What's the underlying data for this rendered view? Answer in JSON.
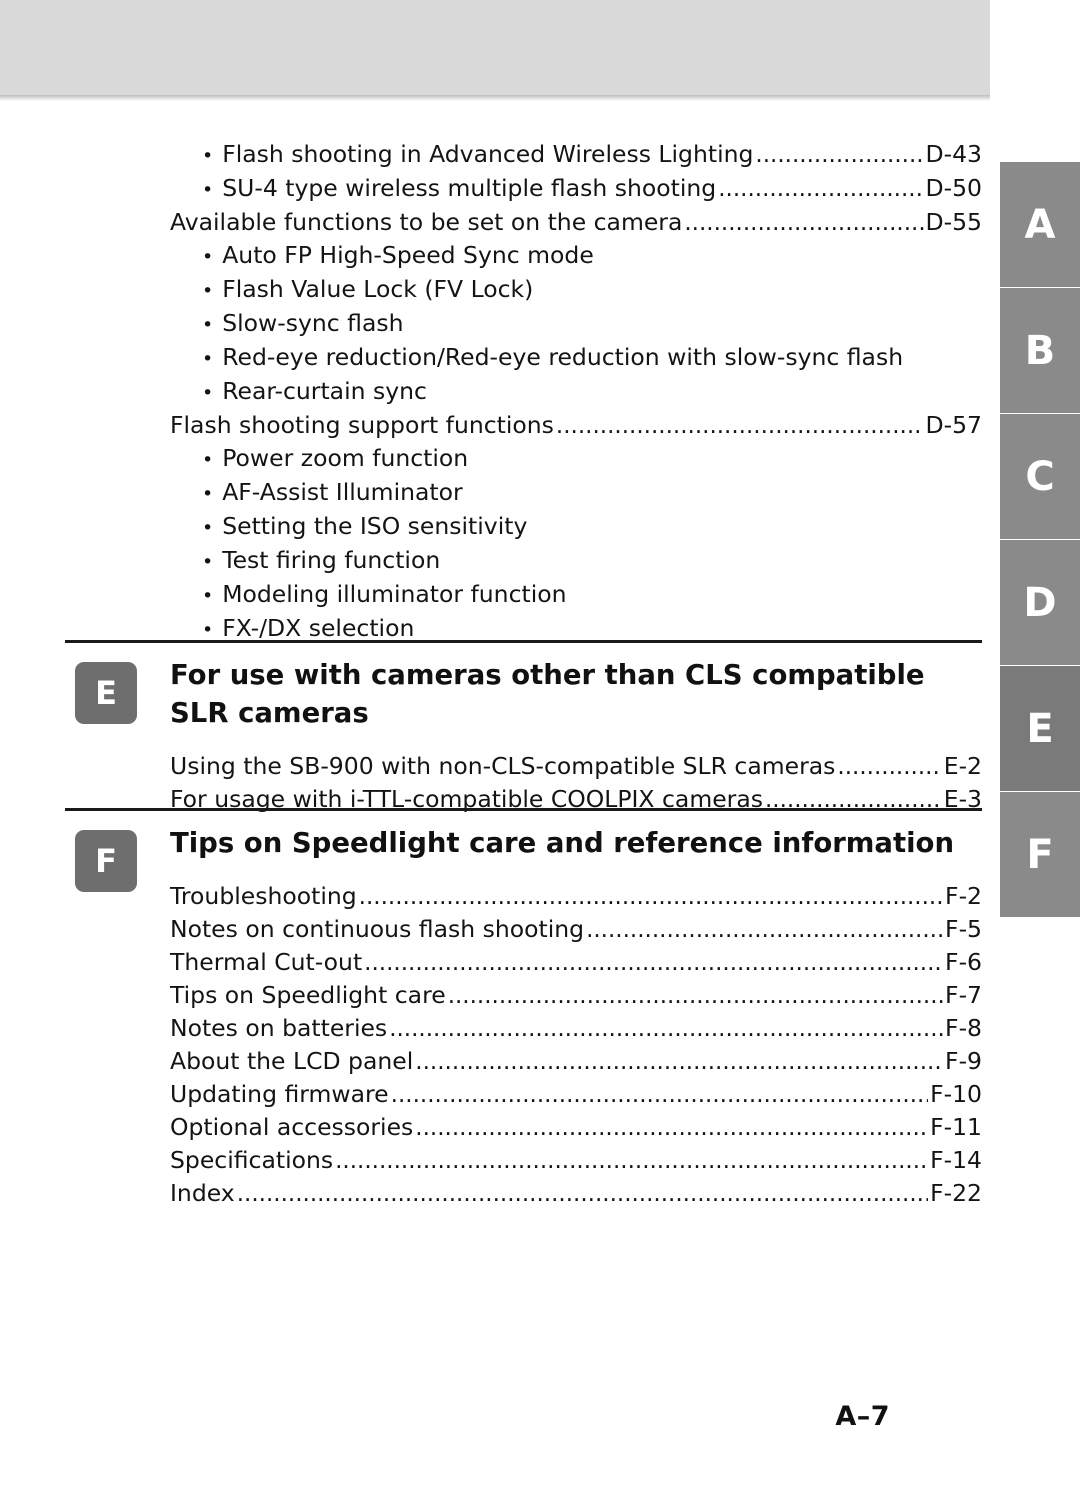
{
  "page": {
    "number_label": "A–7"
  },
  "thumb_index": {
    "tabs": [
      {
        "label": "A",
        "color": "#8a8a8a"
      },
      {
        "label": "B",
        "color": "#8a8a8a"
      },
      {
        "label": "C",
        "color": "#8a8a8a"
      },
      {
        "label": "D",
        "color": "#8a8a8a"
      },
      {
        "label": "E",
        "color": "#7a7a7a"
      },
      {
        "label": "F",
        "color": "#8a8a8a"
      }
    ]
  },
  "toc": {
    "top_entries": [
      {
        "bullet": "•",
        "text": "Flash shooting in Advanced Wireless Lighting",
        "page": "D-43",
        "indent": true,
        "dots": true
      },
      {
        "bullet": "•",
        "text": "SU-4 type wireless multiple flash shooting",
        "page": "D-50",
        "indent": true,
        "dots": true
      },
      {
        "bullet": "",
        "text": "Available functions to be set on the camera",
        "page": "D-55",
        "indent": false,
        "dots": true
      },
      {
        "bullet": "•",
        "text": "Auto FP High-Speed Sync mode",
        "page": "",
        "indent": true,
        "dots": false
      },
      {
        "bullet": "•",
        "text": "Flash Value Lock (FV Lock)",
        "page": "",
        "indent": true,
        "dots": false
      },
      {
        "bullet": "•",
        "text": "Slow-sync flash",
        "page": "",
        "indent": true,
        "dots": false
      },
      {
        "bullet": "•",
        "text": "Red-eye reduction/Red-eye reduction with slow-sync flash",
        "page": "",
        "indent": true,
        "dots": false
      },
      {
        "bullet": "•",
        "text": "Rear-curtain sync",
        "page": "",
        "indent": true,
        "dots": false
      },
      {
        "bullet": "",
        "text": "Flash shooting support functions",
        "page": "D-57",
        "indent": false,
        "dots": true
      },
      {
        "bullet": "•",
        "text": "Power zoom function",
        "page": "",
        "indent": true,
        "dots": false
      },
      {
        "bullet": "•",
        "text": "AF-Assist Illuminator",
        "page": "",
        "indent": true,
        "dots": false
      },
      {
        "bullet": "•",
        "text": "Setting the ISO sensitivity",
        "page": "",
        "indent": true,
        "dots": false
      },
      {
        "bullet": "•",
        "text": "Test firing function",
        "page": "",
        "indent": true,
        "dots": false
      },
      {
        "bullet": "•",
        "text": "Modeling illuminator function",
        "page": "",
        "indent": true,
        "dots": false
      },
      {
        "bullet": "•",
        "text": "FX-/DX selection",
        "page": "",
        "indent": true,
        "dots": false
      }
    ],
    "sections": [
      {
        "badge": "E",
        "title": "For use with cameras other than CLS compatible SLR cameras",
        "entries": [
          {
            "bullet": "",
            "text": "Using the SB-900 with non-CLS-compatible SLR cameras",
            "page": "E-2",
            "indent": false,
            "dots": true
          },
          {
            "bullet": "",
            "text": "For usage with i-TTL-compatible COOLPIX cameras",
            "page": "E-3",
            "indent": false,
            "dots": true
          }
        ]
      },
      {
        "badge": "F",
        "title": "Tips on Speedlight care and reference information",
        "entries": [
          {
            "bullet": "",
            "text": "Troubleshooting",
            "page": "F-2",
            "indent": false,
            "dots": true
          },
          {
            "bullet": "",
            "text": "Notes on continuous flash shooting",
            "page": "F-5",
            "indent": false,
            "dots": true
          },
          {
            "bullet": "",
            "text": "Thermal Cut-out",
            "page": "F-6",
            "indent": false,
            "dots": true
          },
          {
            "bullet": "",
            "text": "Tips on Speedlight care",
            "page": "F-7",
            "indent": false,
            "dots": true
          },
          {
            "bullet": "",
            "text": "Notes on batteries",
            "page": "F-8",
            "indent": false,
            "dots": true
          },
          {
            "bullet": "",
            "text": "About the LCD panel",
            "page": "F-9",
            "indent": false,
            "dots": true
          },
          {
            "bullet": "",
            "text": "Updating firmware",
            "page": "F-10",
            "indent": false,
            "dots": true
          },
          {
            "bullet": "",
            "text": "Optional accessories",
            "page": "F-11",
            "indent": false,
            "dots": true
          },
          {
            "bullet": "",
            "text": "Specifications",
            "page": "F-14",
            "indent": false,
            "dots": true
          },
          {
            "bullet": "",
            "text": "Index",
            "page": "F-22",
            "indent": false,
            "dots": true
          }
        ]
      }
    ]
  }
}
